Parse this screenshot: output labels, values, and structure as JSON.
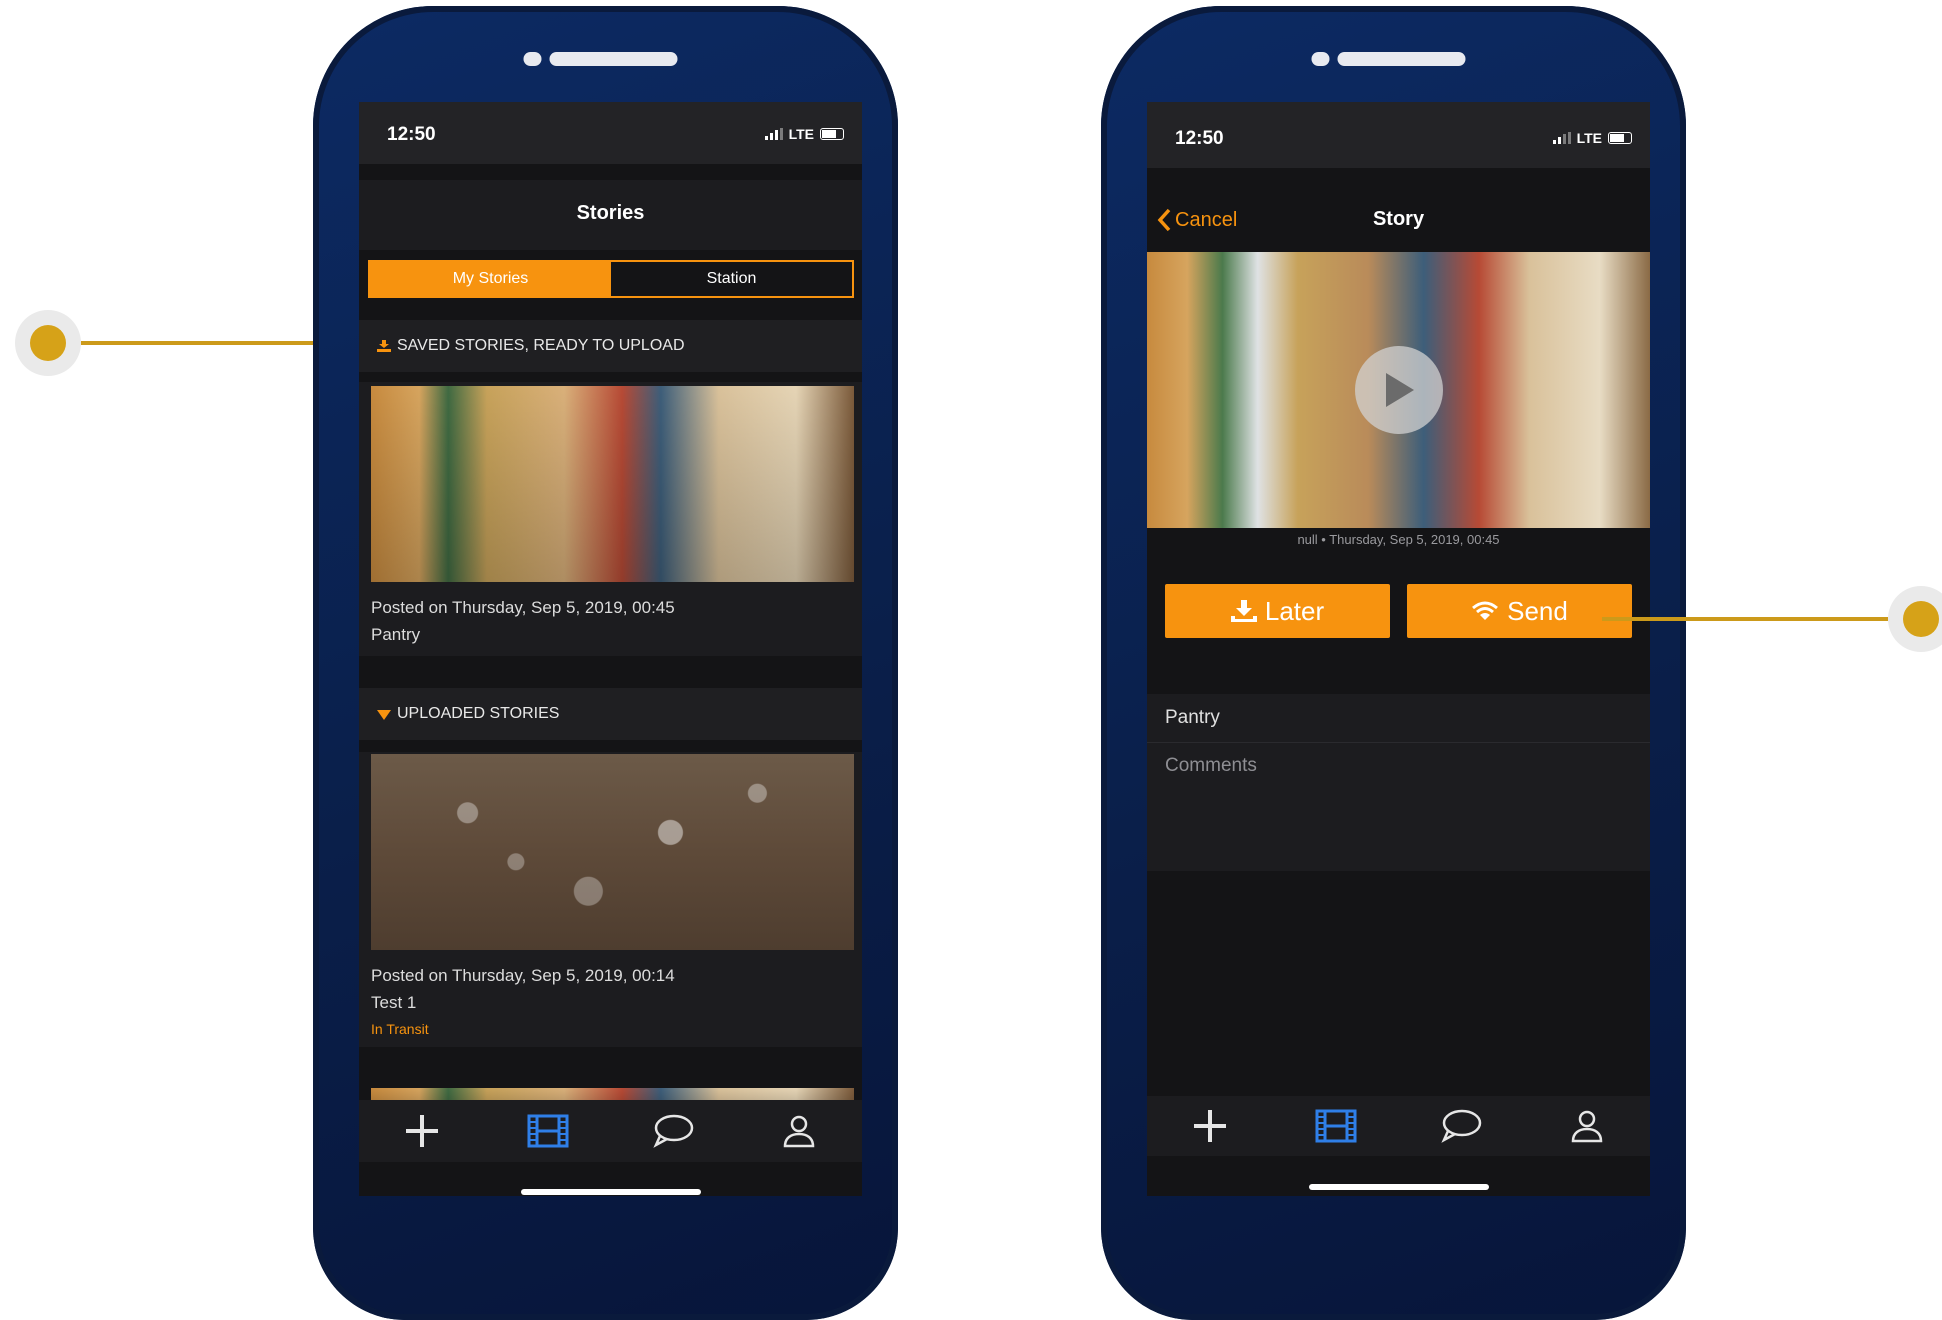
{
  "left_phone": {
    "time": "12:50",
    "network": "LTE",
    "title": "Stories",
    "segments": [
      "My Stories",
      "Station"
    ],
    "saved_header": "SAVED STORIES, READY TO UPLOAD",
    "saved_story": {
      "posted": "Posted on Thursday, Sep 5, 2019, 00:45",
      "name": "Pantry"
    },
    "uploaded_header": "UPLOADED STORIES",
    "uploaded_story": {
      "posted": "Posted on Thursday, Sep 5, 2019, 00:14",
      "name": "Test 1",
      "status": "In Transit"
    },
    "tabs": [
      "plus-icon",
      "film-icon",
      "chat-icon",
      "person-icon"
    ]
  },
  "right_phone": {
    "time": "12:50",
    "network": "LTE",
    "cancel": "Cancel",
    "title": "Story",
    "caption": "null • Thursday, Sep 5, 2019, 00:45",
    "later": "Later",
    "send": "Send",
    "name_field": "Pantry",
    "comments_placeholder": "Comments",
    "tabs": [
      "plus-icon",
      "film-icon",
      "chat-icon",
      "person-icon"
    ]
  },
  "colors": {
    "accent": "#f7930f",
    "active_tab": "#2f7fe8",
    "callout": "#cc9a1a",
    "phone": "#0c2a63"
  }
}
